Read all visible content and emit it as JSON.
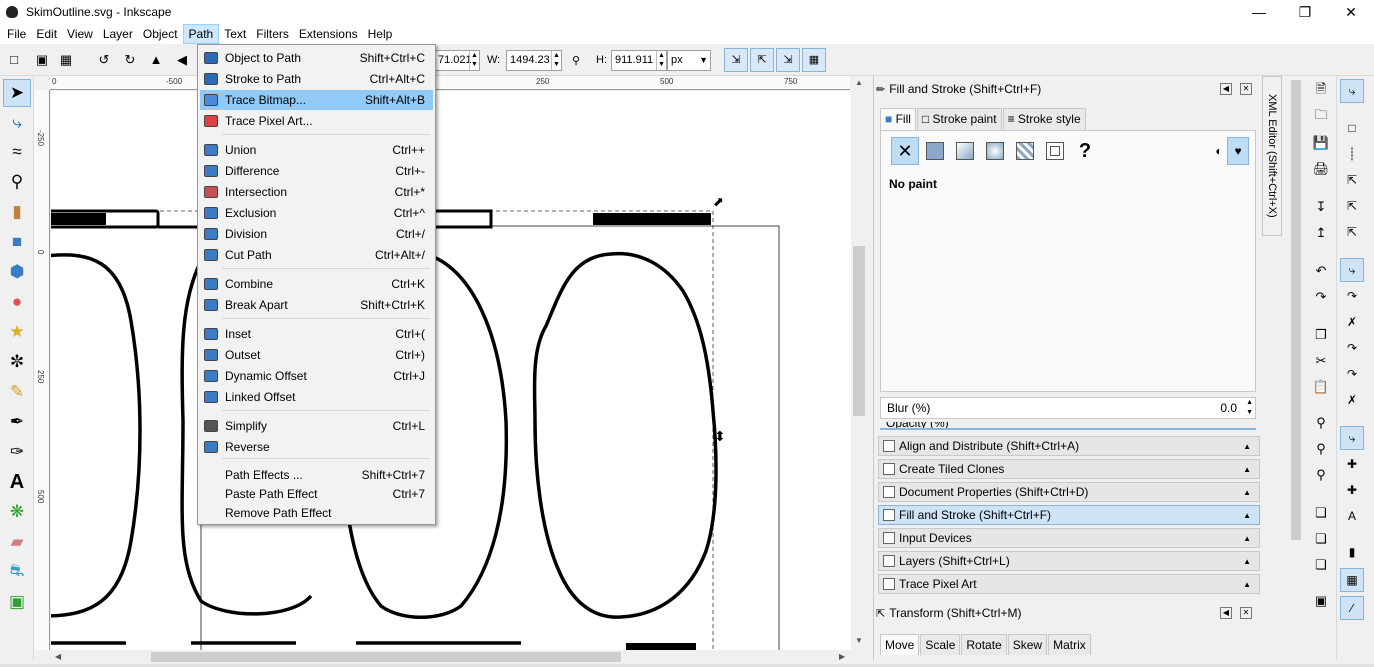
{
  "window": {
    "title": "SkimOutline.svg - Inkscape",
    "minimize_icon": "minimize-icon",
    "maximize_icon": "restore-icon",
    "close_icon": "close-icon"
  },
  "menubar": {
    "items": [
      "File",
      "Edit",
      "View",
      "Layer",
      "Object",
      "Path",
      "Text",
      "Filters",
      "Extensions",
      "Help"
    ],
    "active": "Path"
  },
  "toolctrl": {
    "x_value": "71.021",
    "w_label": "W:",
    "w_value": "1494.23",
    "h_label": "H:",
    "h_value": "911.911",
    "unit": "px"
  },
  "rulers": {
    "h_ticks": [
      "0",
      "-500",
      "250",
      "500",
      "750"
    ],
    "v_ticks": [
      "-250",
      "0",
      "250",
      "500"
    ]
  },
  "path_menu": {
    "items": [
      {
        "label": "Object to Path",
        "shortcut": "Shift+Ctrl+C",
        "icon": "object-to-path-icon",
        "color": "#2a6ab8"
      },
      {
        "label": "Stroke to Path",
        "shortcut": "Ctrl+Alt+C",
        "icon": "stroke-to-path-icon",
        "color": "#2a6ab8"
      },
      {
        "label": "Trace Bitmap...",
        "shortcut": "Shift+Alt+B",
        "icon": "trace-bitmap-icon",
        "color": "#4a8ad8",
        "highlighted": true
      },
      {
        "label": "Trace Pixel Art...",
        "shortcut": "",
        "icon": "trace-pixel-art-icon",
        "color": "#e04040"
      },
      {
        "label": "Union",
        "shortcut": "Ctrl++",
        "icon": "union-icon",
        "color": "#3b7cc4"
      },
      {
        "label": "Difference",
        "shortcut": "Ctrl+-",
        "icon": "difference-icon",
        "color": "#3b7cc4"
      },
      {
        "label": "Intersection",
        "shortcut": "Ctrl+*",
        "icon": "intersection-icon",
        "color": "#c85050"
      },
      {
        "label": "Exclusion",
        "shortcut": "Ctrl+^",
        "icon": "exclusion-icon",
        "color": "#3b7cc4"
      },
      {
        "label": "Division",
        "shortcut": "Ctrl+/",
        "icon": "division-icon",
        "color": "#3b7cc4"
      },
      {
        "label": "Cut Path",
        "shortcut": "Ctrl+Alt+/",
        "icon": "cut-path-icon",
        "color": "#3b7cc4"
      },
      {
        "label": "Combine",
        "shortcut": "Ctrl+K",
        "icon": "combine-icon",
        "color": "#3b7cc4"
      },
      {
        "label": "Break Apart",
        "shortcut": "Shift+Ctrl+K",
        "icon": "break-apart-icon",
        "color": "#3b7cc4"
      },
      {
        "label": "Inset",
        "shortcut": "Ctrl+(",
        "icon": "inset-icon",
        "color": "#3b7cc4"
      },
      {
        "label": "Outset",
        "shortcut": "Ctrl+)",
        "icon": "outset-icon",
        "color": "#3b7cc4"
      },
      {
        "label": "Dynamic Offset",
        "shortcut": "Ctrl+J",
        "icon": "dynamic-offset-icon",
        "color": "#3b7cc4"
      },
      {
        "label": "Linked Offset",
        "shortcut": "",
        "icon": "linked-offset-icon",
        "color": "#3b7cc4"
      },
      {
        "label": "Simplify",
        "shortcut": "Ctrl+L",
        "icon": "simplify-icon",
        "color": "#555555"
      },
      {
        "label": "Reverse",
        "shortcut": "",
        "icon": "reverse-icon",
        "color": "#3b7cc4"
      },
      {
        "label": "Path Effects ...",
        "shortcut": "Shift+Ctrl+7",
        "icon": "",
        "color": ""
      },
      {
        "label": "Paste Path Effect",
        "shortcut": "Ctrl+7",
        "icon": "",
        "color": ""
      },
      {
        "label": "Remove Path Effect",
        "shortcut": "",
        "icon": "",
        "color": ""
      }
    ]
  },
  "fill_stroke": {
    "title": "Fill and Stroke (Shift+Ctrl+F)",
    "tabs": [
      "Fill",
      "Stroke paint",
      "Stroke style"
    ],
    "status": "No paint",
    "question_mark": "?",
    "blur_label": "Blur (%)",
    "blur_value": "0.0",
    "opacity_partial": "Opacity (%)"
  },
  "dock_panels": [
    {
      "title": "Align and Distribute (Shift+Ctrl+A)",
      "current": false
    },
    {
      "title": "Create Tiled Clones",
      "current": false
    },
    {
      "title": "Document Properties (Shift+Ctrl+D)",
      "current": false
    },
    {
      "title": "Fill and Stroke (Shift+Ctrl+F)",
      "current": true
    },
    {
      "title": "Input Devices",
      "current": false
    },
    {
      "title": "Layers (Shift+Ctrl+L)",
      "current": false
    },
    {
      "title": "Trace Pixel Art",
      "current": false
    }
  ],
  "transform": {
    "title": "Transform (Shift+Ctrl+M)",
    "tabs": [
      "Move",
      "Scale",
      "Rotate",
      "Skew",
      "Matrix"
    ]
  },
  "xml_editor_tab": "XML Editor (Shift+Ctrl+X)",
  "canvas": {
    "label_left": "",
    "label_right": ""
  },
  "colors": {
    "menu_highlight": "#91c9f7",
    "active_menu": "#cce8ff",
    "panel_current": "#cfe3f7"
  }
}
